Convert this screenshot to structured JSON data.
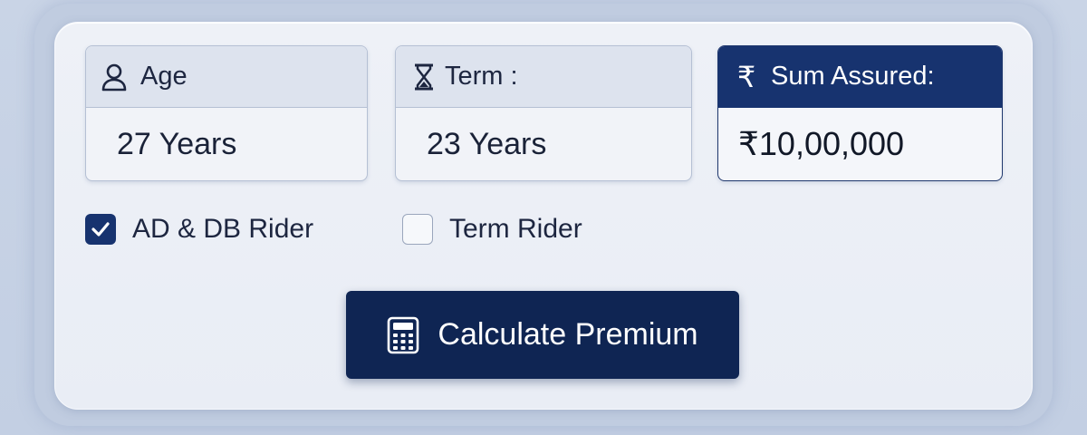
{
  "fields": {
    "age": {
      "label": "Age",
      "value": "27 Years",
      "icon": "user-icon"
    },
    "term": {
      "label": "Term :",
      "value": "23 Years",
      "icon": "hourglass-icon"
    },
    "sum_assured": {
      "label": "Sum Assured:",
      "value": "₹10,00,000",
      "icon": "rupee-icon",
      "currency_symbol": "₹"
    }
  },
  "riders": [
    {
      "label": "AD & DB Rider",
      "checked": true
    },
    {
      "label": "Term Rider",
      "checked": false
    }
  ],
  "action": {
    "label": "Calculate Premium",
    "icon": "calculator-icon"
  },
  "colors": {
    "accent": "#17336f",
    "button": "#0f2553",
    "background": "#c9d4e6",
    "card": "#eef1f7"
  }
}
